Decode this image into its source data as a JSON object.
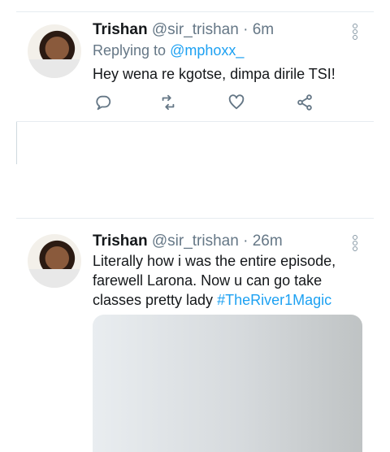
{
  "tweets": [
    {
      "name": "Trishan",
      "handle": "@sir_trishan",
      "separator": "·",
      "time": "6m",
      "replying_prefix": "Replying to",
      "replying_to": "@mphoxx_",
      "text": "Hey wena re kgotse, dimpa dirile TSI!",
      "actions": [
        "reply-icon",
        "retweet-icon",
        "like-icon",
        "share-icon"
      ]
    },
    {
      "name": "Trishan",
      "handle": "@sir_trishan",
      "separator": "·",
      "time": "26m",
      "text_parts": [
        "Literally how i was the entire episode, farewell Larona. Now u can go take classes pretty lady ",
        "#TheRiver1Magic"
      ]
    }
  ],
  "colors": {
    "accent": "#1da1f2",
    "secondary_text": "#657786",
    "divider": "#e6ecf0",
    "icon": "#657786"
  }
}
